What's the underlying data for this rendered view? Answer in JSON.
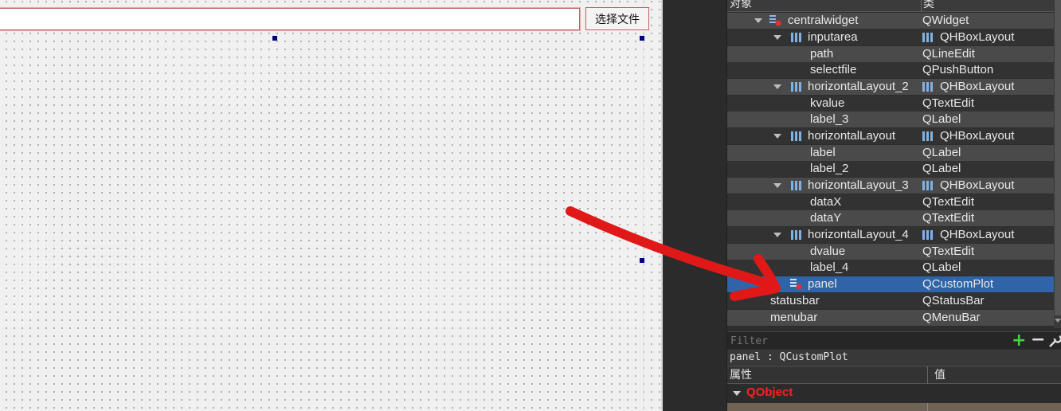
{
  "canvas": {
    "path_value": "",
    "select_button_label": "选择文件"
  },
  "object_inspector": {
    "header": {
      "object_col": "对象",
      "class_col": "类"
    },
    "rows": [
      {
        "name": "centralwidget",
        "class": "QWidget"
      },
      {
        "name": "inputarea",
        "class": "QHBoxLayout"
      },
      {
        "name": "path",
        "class": "QLineEdit"
      },
      {
        "name": "selectfile",
        "class": "QPushButton"
      },
      {
        "name": "horizontalLayout_2",
        "class": "QHBoxLayout"
      },
      {
        "name": "kvalue",
        "class": "QTextEdit"
      },
      {
        "name": "label_3",
        "class": "QLabel"
      },
      {
        "name": "horizontalLayout",
        "class": "QHBoxLayout"
      },
      {
        "name": "label",
        "class": "QLabel"
      },
      {
        "name": "label_2",
        "class": "QLabel"
      },
      {
        "name": "horizontalLayout_3",
        "class": "QHBoxLayout"
      },
      {
        "name": "dataX",
        "class": "QTextEdit"
      },
      {
        "name": "dataY",
        "class": "QTextEdit"
      },
      {
        "name": "horizontalLayout_4",
        "class": "QHBoxLayout"
      },
      {
        "name": "dvalue",
        "class": "QTextEdit"
      },
      {
        "name": "label_4",
        "class": "QLabel"
      },
      {
        "name": "panel",
        "class": "QCustomPlot"
      },
      {
        "name": "statusbar",
        "class": "QStatusBar"
      },
      {
        "name": "menubar",
        "class": "QMenuBar"
      }
    ],
    "selected": "panel",
    "filter_placeholder": "Filter",
    "selected_object_label": "panel : QCustomPlot"
  },
  "property_editor": {
    "header": {
      "property_col": "属性",
      "value_col": "值"
    },
    "group": "QObject"
  },
  "colors": {
    "selection": "#2f65a8",
    "annotation_arrow": "#e01818",
    "qobject_group": "#ff2020",
    "add_icon": "#3fd63f"
  }
}
